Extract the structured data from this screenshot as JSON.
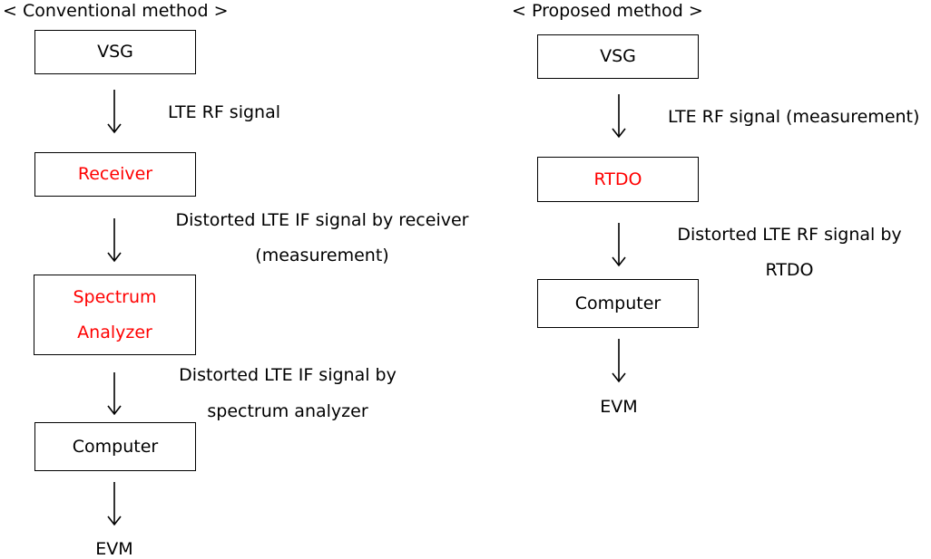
{
  "conventional": {
    "title": "< Conventional method >",
    "boxes": [
      {
        "label": "VSG",
        "highlight": false
      },
      {
        "label": "Receiver",
        "highlight": true
      },
      {
        "label_lines": [
          "Spectrum",
          "Analyzer"
        ],
        "highlight": true
      },
      {
        "label": "Computer",
        "highlight": false
      }
    ],
    "edges": [
      {
        "lines": [
          "LTE RF signal"
        ]
      },
      {
        "lines": [
          "Distorted LTE IF signal by receiver",
          "(measurement)"
        ]
      },
      {
        "lines": [
          "Distorted LTE IF signal by",
          "spectrum analyzer"
        ]
      },
      {
        "lines": []
      }
    ],
    "output": "EVM"
  },
  "proposed": {
    "title": "< Proposed method >",
    "boxes": [
      {
        "label": "VSG",
        "highlight": false
      },
      {
        "label": "RTDO",
        "highlight": true
      },
      {
        "label": "Computer",
        "highlight": false
      }
    ],
    "edges": [
      {
        "lines": [
          "LTE RF signal (measurement)"
        ]
      },
      {
        "lines": [
          "Distorted LTE RF signal by",
          "RTDO"
        ]
      },
      {
        "lines": []
      }
    ],
    "output": "EVM"
  },
  "colors": {
    "highlight": "#ff0000",
    "default_text": "#000000",
    "border": "#000000"
  }
}
